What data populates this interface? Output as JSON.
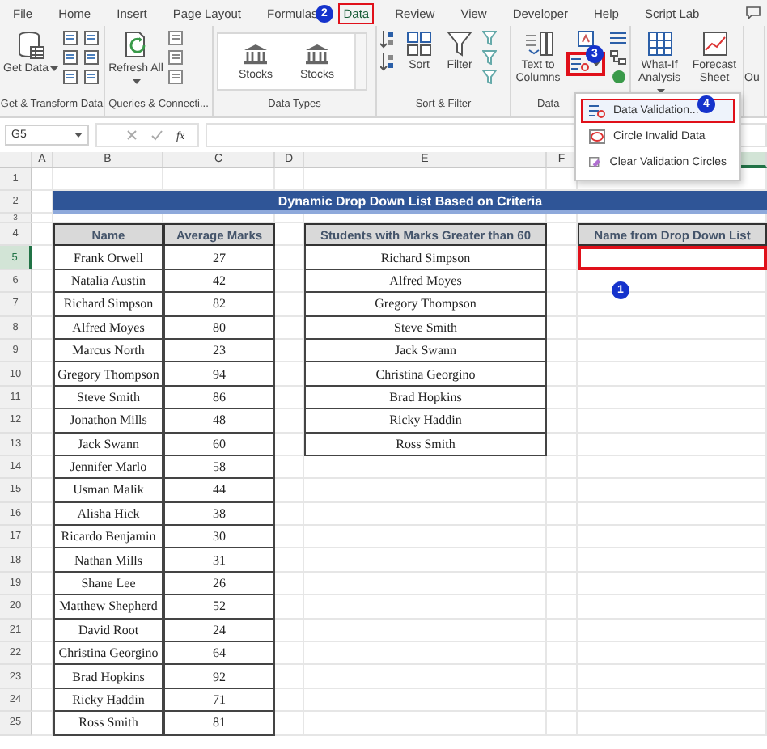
{
  "tabs": [
    {
      "label": "File",
      "selected": false,
      "highlighted": false
    },
    {
      "label": "Home",
      "selected": false,
      "highlighted": false
    },
    {
      "label": "Insert",
      "selected": false,
      "highlighted": false
    },
    {
      "label": "Page Layout",
      "selected": false,
      "highlighted": false
    },
    {
      "label": "Formulas",
      "selected": false,
      "highlighted": false
    },
    {
      "label": "Data",
      "selected": true,
      "highlighted": true
    },
    {
      "label": "Review",
      "selected": false,
      "highlighted": false
    },
    {
      "label": "View",
      "selected": false,
      "highlighted": false
    },
    {
      "label": "Developer",
      "selected": false,
      "highlighted": false
    },
    {
      "label": "Help",
      "selected": false,
      "highlighted": false
    },
    {
      "label": "Script Lab",
      "selected": false,
      "highlighted": false
    }
  ],
  "ribbon": [
    {
      "kind": "get",
      "label": "Get & Transform Data",
      "buttons": [
        {
          "text": "Get Data",
          "caret": true
        }
      ]
    },
    {
      "kind": "queries",
      "label": "Queries & Connecti...",
      "buttons": [
        {
          "text": "Refresh All",
          "caret": true
        }
      ]
    },
    {
      "kind": "types",
      "label": "Data Types",
      "items": [
        "Stocks",
        "Stocks"
      ]
    },
    {
      "kind": "sort",
      "label": "Sort & Filter",
      "buttons": [
        {
          "text": "Sort",
          "caret": false
        },
        {
          "text": "Filter",
          "caret": false
        }
      ]
    },
    {
      "kind": "tools",
      "label": "Data",
      "buttons": [
        {
          "text": "Text to Columns",
          "caret": false
        }
      ],
      "validation_highlighted": true
    },
    {
      "kind": "forecast",
      "buttons": [
        {
          "text": "What-If Analysis",
          "caret": true
        },
        {
          "text": "Forecast Sheet",
          "caret": false
        }
      ]
    },
    {
      "kind": "outline",
      "text": "Ou"
    }
  ],
  "validation_menu": [
    {
      "label": "Data Validation...",
      "highlighted": true
    },
    {
      "label": "Circle Invalid Data",
      "highlighted": false
    },
    {
      "label": "Clear Validation Circles",
      "highlighted": false
    }
  ],
  "formula_bar": {
    "name_box": "G5",
    "function_label": "fx"
  },
  "sheet": {
    "columns": [
      "A",
      "B",
      "C",
      "D",
      "E",
      "F"
    ],
    "row_numbers": [
      "1",
      "2",
      "3",
      "4",
      "5",
      "6",
      "7",
      "8",
      "9",
      "10",
      "11",
      "12",
      "13",
      "14",
      "15",
      "16",
      "17",
      "18",
      "19",
      "20",
      "21",
      "22",
      "23",
      "24",
      "25"
    ],
    "title": "Dynamic Drop Down List Based on Criteria",
    "marks_table": {
      "columns": [
        "Name",
        "Average Marks"
      ],
      "rows": [
        [
          "Frank Orwell",
          "27"
        ],
        [
          "Natalia Austin",
          "42"
        ],
        [
          "Richard Simpson",
          "82"
        ],
        [
          "Alfred Moyes",
          "80"
        ],
        [
          "Marcus North",
          "23"
        ],
        [
          "Gregory Thompson",
          "94"
        ],
        [
          "Steve Smith",
          "86"
        ],
        [
          "Jonathon Mills",
          "48"
        ],
        [
          "Jack Swann",
          "60"
        ],
        [
          "Jennifer Marlo",
          "58"
        ],
        [
          "Usman Malik",
          "44"
        ],
        [
          "Alisha Hick",
          "38"
        ],
        [
          "Ricardo Benjamin",
          "30"
        ],
        [
          "Nathan Mills",
          "31"
        ],
        [
          "Shane Lee",
          "26"
        ],
        [
          "Matthew Shepherd",
          "52"
        ],
        [
          "David Root",
          "24"
        ],
        [
          "Christina Georgino",
          "64"
        ],
        [
          "Brad Hopkins",
          "92"
        ],
        [
          "Ricky Haddin",
          "71"
        ],
        [
          "Ross Smith",
          "81"
        ]
      ]
    },
    "filtered_table": {
      "column": "Students with Marks Greater than 60",
      "rows": [
        "Richard Simpson",
        "Alfred Moyes",
        "Gregory Thompson",
        "Steve Smith",
        "Jack Swann",
        "Christina Georgino",
        "Brad Hopkins",
        "Ricky Haddin",
        "Ross Smith"
      ]
    },
    "drop_down": {
      "column": "Name from Drop Down List",
      "highlighted": true
    }
  },
  "callouts": [
    "1",
    "2",
    "3",
    "4"
  ]
}
